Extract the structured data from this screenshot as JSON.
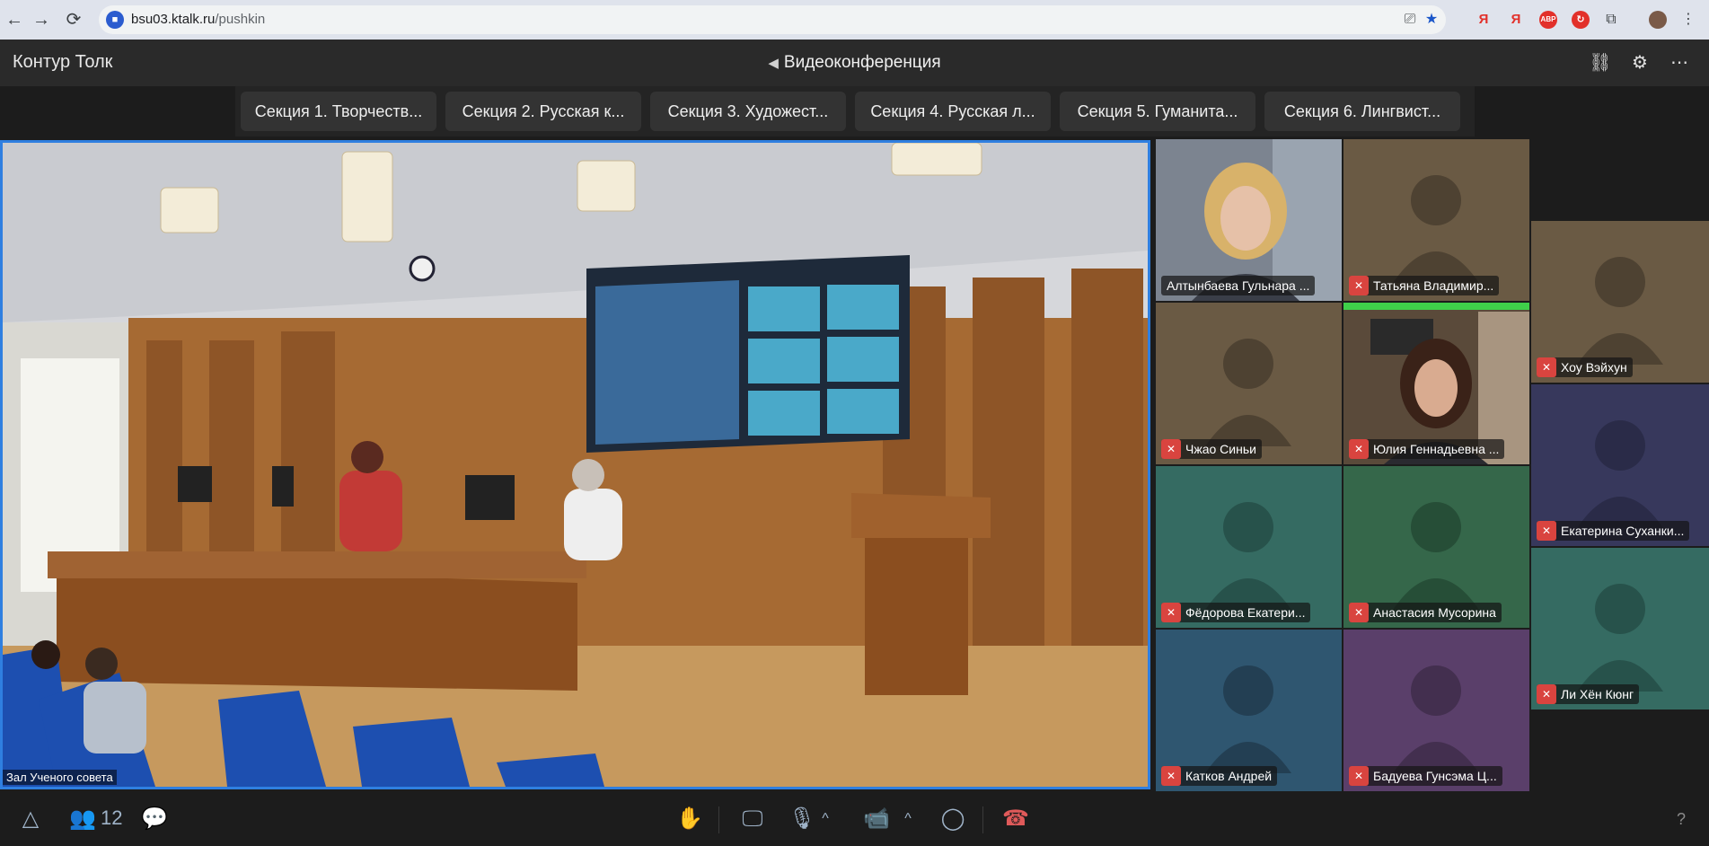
{
  "browser": {
    "url_host": "bsu03.ktalk.ru",
    "url_path": "/pushkin",
    "extensions": [
      {
        "label": "Я",
        "color": "#e2302a"
      },
      {
        "label": "Я",
        "color": "#e2302a"
      },
      {
        "label": "ABP",
        "color": "#e2302a"
      },
      {
        "label": "↻",
        "color": "#e2302a"
      }
    ]
  },
  "app": {
    "brand": "Контур Толк",
    "title": "Видеоконференция"
  },
  "tabs": [
    "Секция 1. Творчеств...",
    "Секция 2. Русская к...",
    "Секция 3. Художест...",
    "Секция 4. Русская л...",
    "Секция 5. Гуманита...",
    "Секция 6. Лингвист..."
  ],
  "main_video": {
    "label": "Зал Ученого совета"
  },
  "participants": [
    {
      "name": "Алтынбаева Гульнара ...",
      "muted": false,
      "video": true,
      "bg": "#6a6f78"
    },
    {
      "name": "Татьяна Владимир...",
      "muted": true,
      "video": false,
      "bg": "#6a5a44"
    },
    {
      "name": "Хоу Вэйхун",
      "muted": true,
      "video": false,
      "bg": "#6a5a44"
    },
    {
      "name": "Чжао Синьи",
      "muted": true,
      "video": false,
      "bg": "#6a5a44"
    },
    {
      "name": "Юлия Геннадьевна ...",
      "muted": true,
      "video": true,
      "bg": "#4a3a30"
    },
    {
      "name": "Екатерина Суханки...",
      "muted": true,
      "video": false,
      "bg": "#37385c"
    },
    {
      "name": "Фёдорова Екатери...",
      "muted": true,
      "video": false,
      "bg": "#356b62"
    },
    {
      "name": "Анастасия Мусорина",
      "muted": true,
      "video": false,
      "bg": "#35674a"
    },
    {
      "name": "Ли Хён Кюнг",
      "muted": true,
      "video": false,
      "bg": "#356b62"
    },
    {
      "name": "Катков Андрей",
      "muted": true,
      "video": false,
      "bg": "#2f5670"
    },
    {
      "name": "Бадуева Гунсэма Ц...",
      "muted": true,
      "video": false,
      "bg": "#5a3f6a"
    }
  ],
  "toolbar": {
    "participants_count": "12",
    "help": "?"
  },
  "colors": {
    "accent": "#2f7fe0",
    "mute": "#d9443f",
    "hangup": "#e05a5a"
  }
}
